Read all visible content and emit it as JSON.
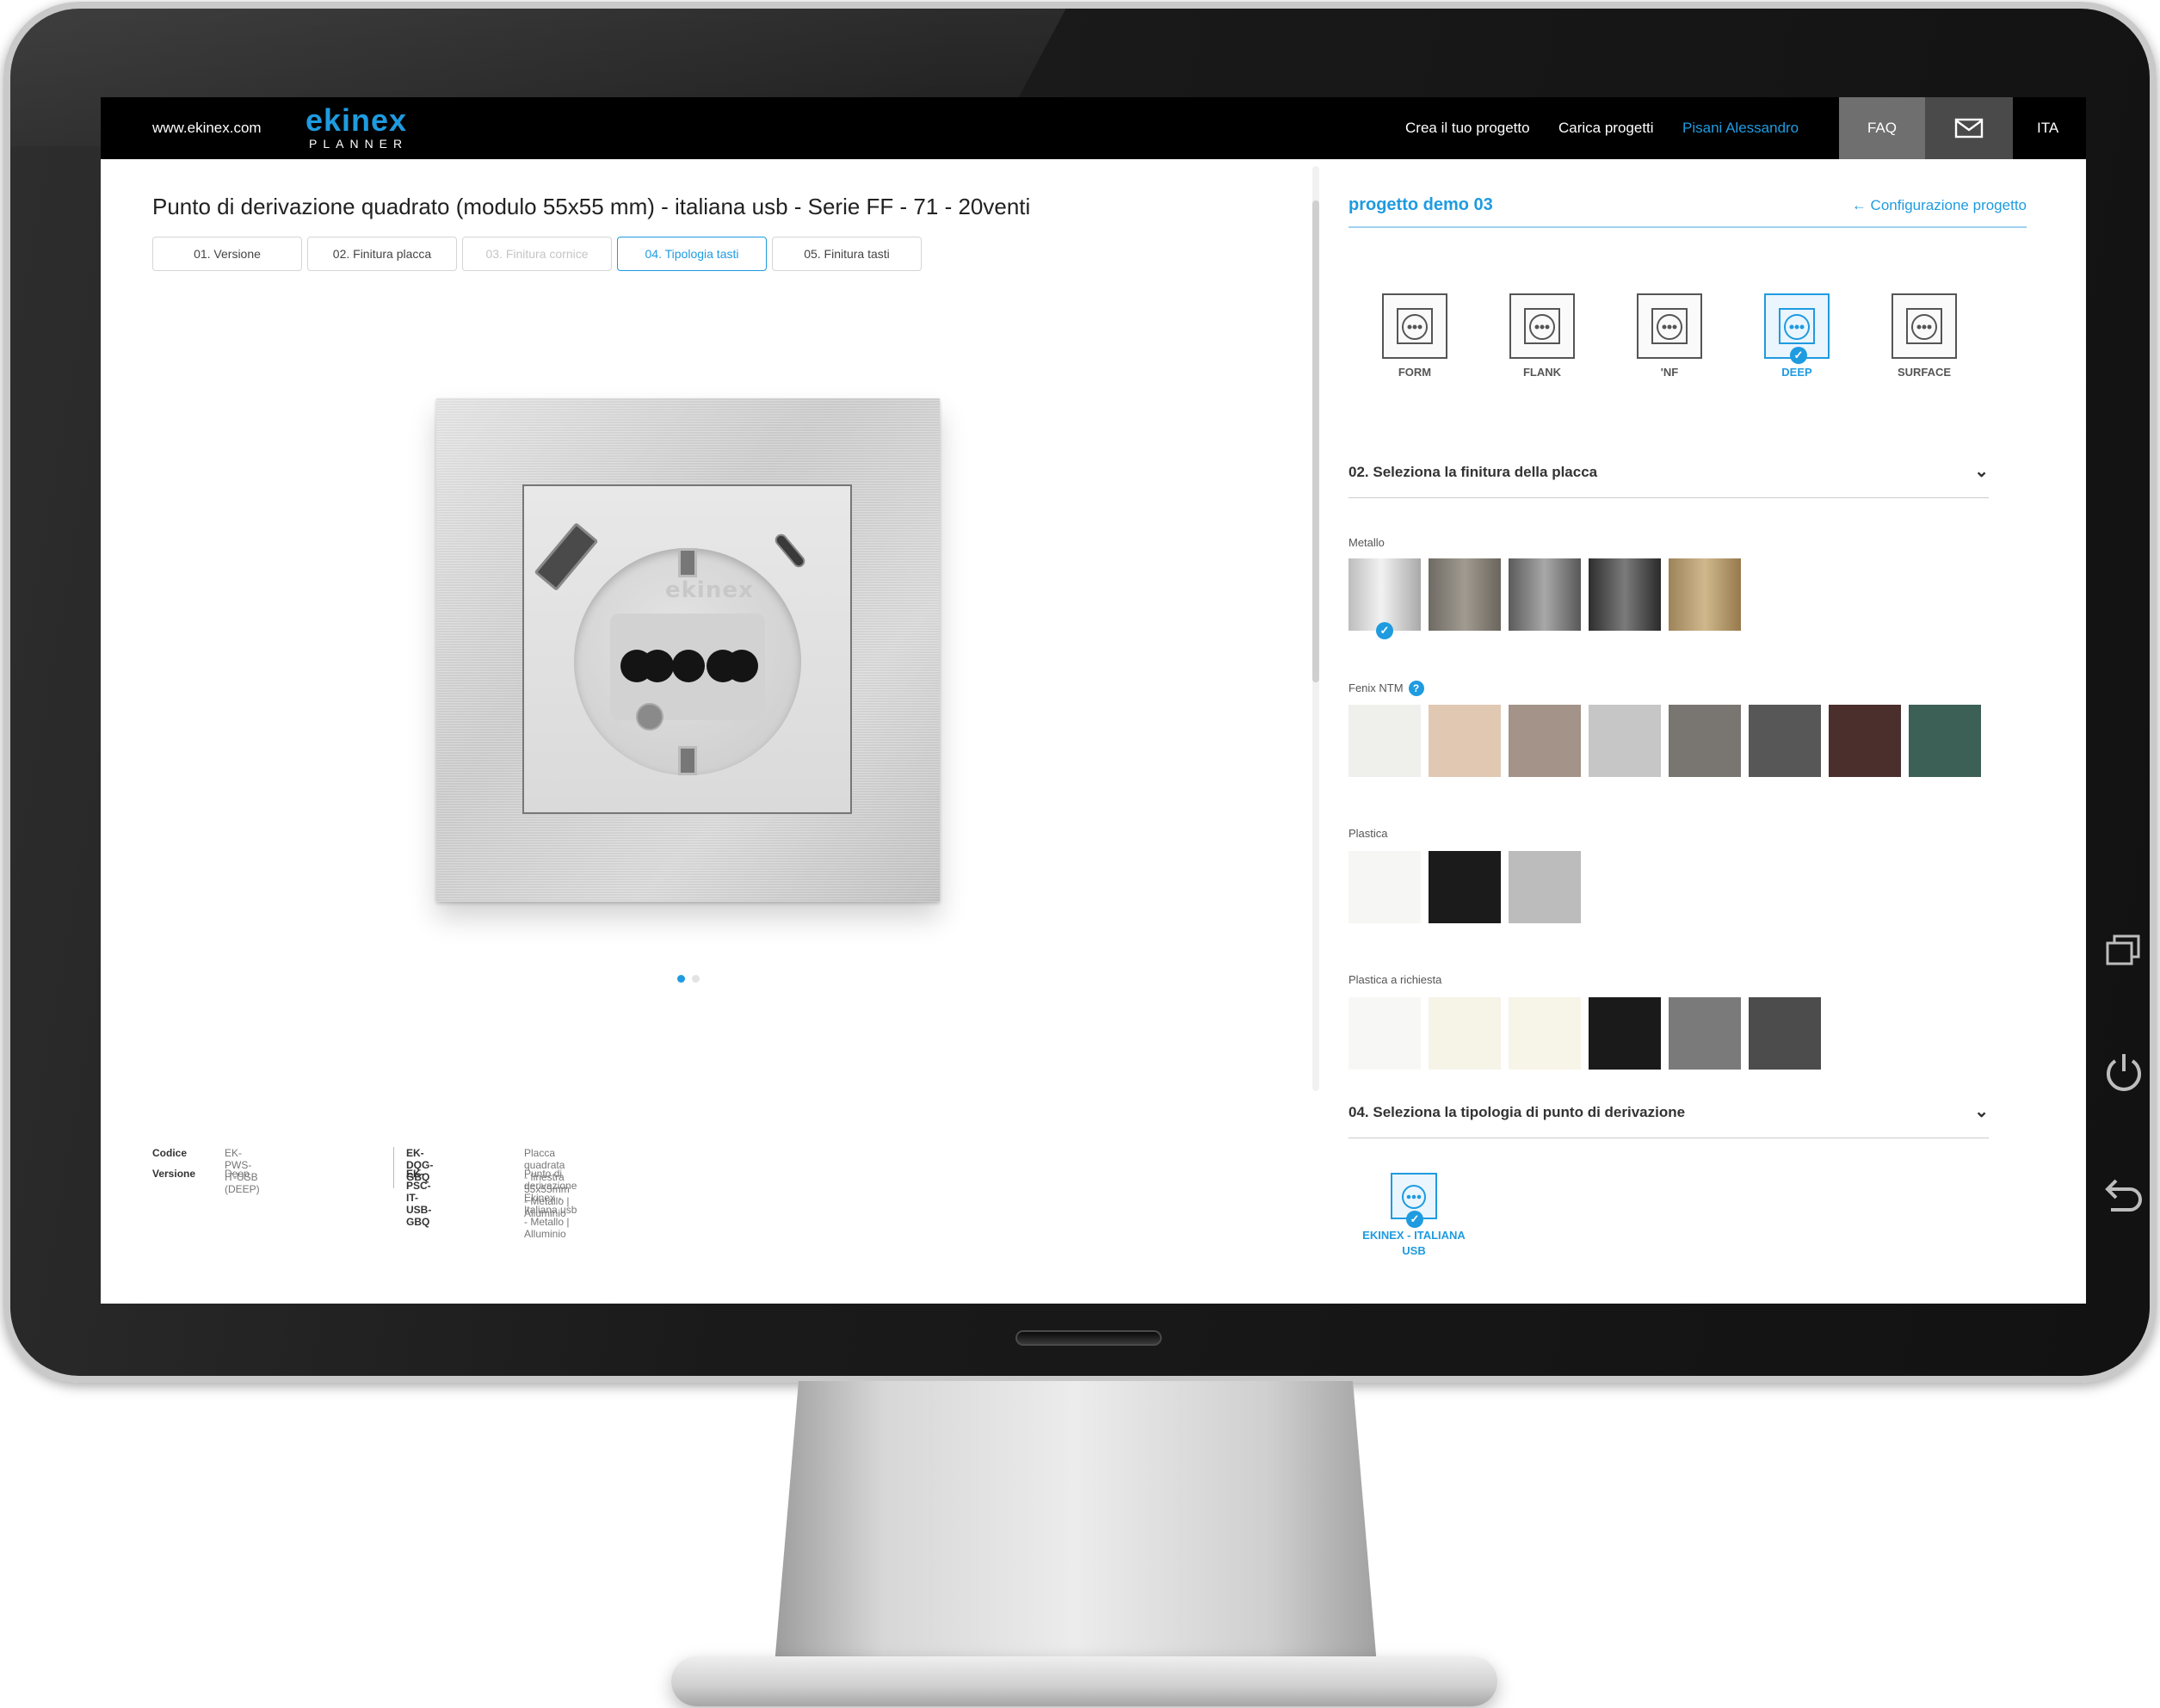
{
  "topbar": {
    "site_url": "www.ekinex.com",
    "logo_main": "ekinex",
    "logo_sub": "PLANNER",
    "nav": [
      "Crea il tuo progetto",
      "Carica progetti"
    ],
    "user": "Pisani Alessandro",
    "faq": "FAQ",
    "language": "ITA"
  },
  "product": {
    "title": "Punto di derivazione quadrato (modulo 55x55 mm) - italiana usb - Serie FF - 71 - 20venti",
    "emboss": "ekinex"
  },
  "steps": [
    {
      "label": "01. Versione",
      "state": "normal"
    },
    {
      "label": "02. Finitura placca",
      "state": "normal"
    },
    {
      "label": "03. Finitura cornice",
      "state": "disabled"
    },
    {
      "label": "04. Tipologia tasti",
      "state": "active"
    },
    {
      "label": "05. Finitura tasti",
      "state": "normal"
    }
  ],
  "carousel": {
    "count": 2,
    "active": 1
  },
  "specs": {
    "codice_label": "Codice",
    "codice_value": "EK-PWS-IT-USB (DEEP)",
    "versione_label": "Versione",
    "versione_value": "Deep",
    "items": [
      {
        "code": "EK-DQG-GBQ",
        "desc": "Placca quadrata - finestra 55x55mm - Metallo | Alluminio"
      },
      {
        "code": "EK-PSC-IT-USB-GBQ",
        "desc": "Punto di derivazione Ekinex - Italiana usb - Metallo | Alluminio"
      }
    ]
  },
  "panel": {
    "project_name": "progetto demo 03",
    "config_link": "← Configurazione progetto",
    "versions": [
      {
        "label": "FORM",
        "selected": false
      },
      {
        "label": "FLANK",
        "selected": false
      },
      {
        "label": "'NF",
        "selected": false
      },
      {
        "label": "DEEP",
        "selected": true
      },
      {
        "label": "SURFACE",
        "selected": false
      }
    ],
    "section_finish": "02. Seleziona la finitura della placca",
    "groups": [
      {
        "label": "Metallo",
        "help": false,
        "swatches": [
          {
            "color": "linear-gradient(90deg,#bdbdbd,#f2f2f2 45%,#a9a9a9)",
            "selected": true
          },
          {
            "color": "linear-gradient(90deg,#6e6a64,#a19b90 50%,#6a655d)",
            "selected": false
          },
          {
            "color": "linear-gradient(90deg,#5b5b5b,#a8a8a8 50%,#585858)",
            "selected": false
          },
          {
            "color": "linear-gradient(90deg,#2e2e2e,#7b7b7b 50%,#2a2a2a)",
            "selected": false
          },
          {
            "color": "linear-gradient(90deg,#9d835a,#d0b88d 50%,#96794d)",
            "selected": false
          }
        ]
      },
      {
        "label": "Fenix NTM",
        "help": true,
        "swatches": [
          {
            "color": "#efefec",
            "selected": false
          },
          {
            "color": "#e1c8b3",
            "selected": false
          },
          {
            "color": "#a39389",
            "selected": false
          },
          {
            "color": "#c6c6c6",
            "selected": false
          },
          {
            "color": "#797570",
            "selected": false
          },
          {
            "color": "#575757",
            "selected": false
          },
          {
            "color": "#4a2f2d",
            "selected": false
          },
          {
            "color": "#3c5f56",
            "selected": false
          }
        ]
      },
      {
        "label": "Plastica",
        "help": false,
        "swatches": [
          {
            "color": "#f6f6f4",
            "selected": false
          },
          {
            "color": "#1b1b1b",
            "selected": false
          },
          {
            "color": "#bcbcbc",
            "selected": false
          }
        ]
      },
      {
        "label": "Plastica a richiesta",
        "help": false,
        "swatches": [
          {
            "color": "#f7f7f5",
            "selected": false
          },
          {
            "color": "#f6f3e7",
            "selected": false
          },
          {
            "color": "#f7f4e8",
            "selected": false
          },
          {
            "color": "#1a1a1a",
            "selected": false
          },
          {
            "color": "#7a7a7a",
            "selected": false
          },
          {
            "color": "#4c4c4c",
            "selected": false
          }
        ]
      }
    ],
    "section_type": "04. Seleziona la tipologia di punto di derivazione",
    "type_option": "EKINEX - ITALIANA USB"
  }
}
